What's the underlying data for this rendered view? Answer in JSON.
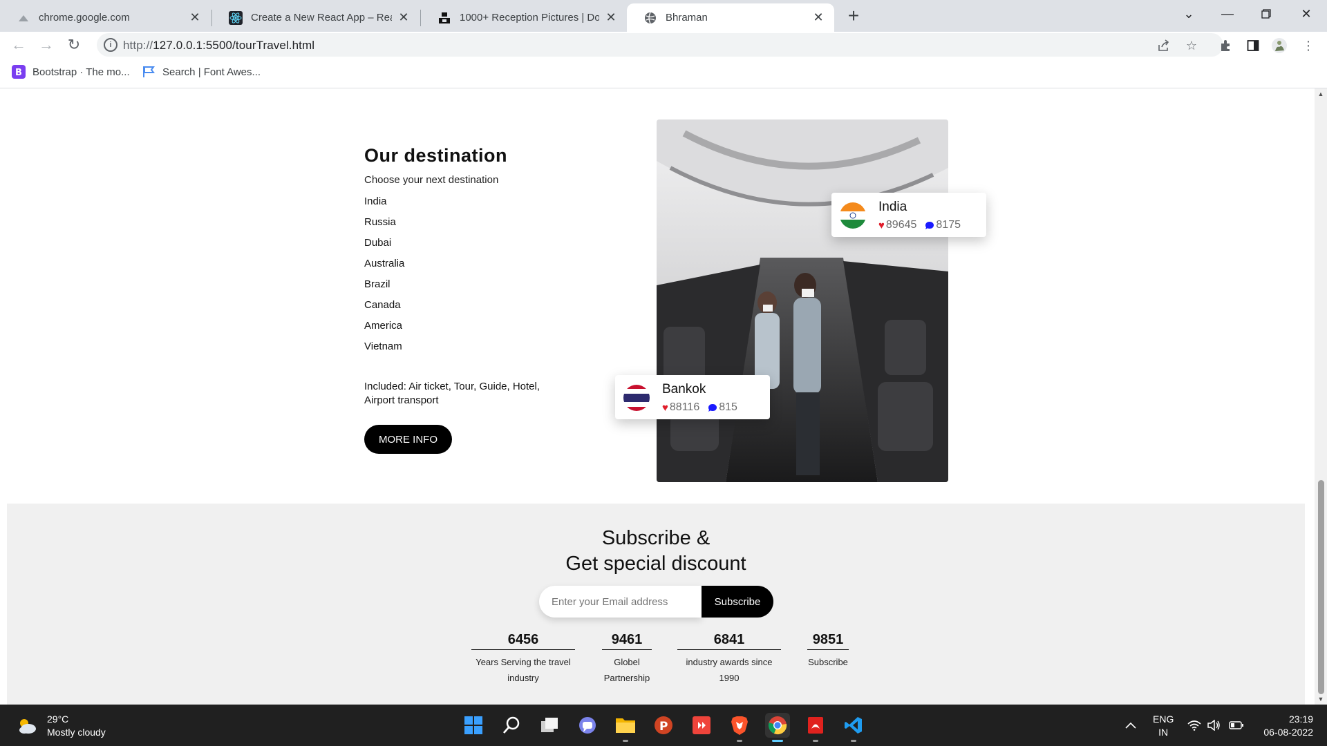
{
  "browser": {
    "tabs": [
      {
        "title": "chrome.google.com",
        "icon": "chrome-webstore-icon",
        "active": false
      },
      {
        "title": "Create a New React App – React",
        "icon": "react-icon",
        "active": false
      },
      {
        "title": "1000+ Reception Pictures | Down",
        "icon": "unsplash-icon",
        "active": false
      },
      {
        "title": "Bhraman",
        "icon": "globe-icon",
        "active": true
      }
    ],
    "url_prefix": "http://",
    "url_main": "127.0.0.1:5500/tourTravel.html",
    "bookmarks": [
      {
        "label": "Bootstrap · The mo...",
        "icon": "bootstrap-icon"
      },
      {
        "label": "Search | Font Awes...",
        "icon": "font-awesome-flag-icon"
      }
    ]
  },
  "destination": {
    "title": "Our destination",
    "subtitle": "Choose your next destination",
    "countries": [
      "India",
      "Russia",
      "Dubai",
      "Australia",
      "Brazil",
      "Canada",
      "America",
      "Vietnam"
    ],
    "included": "Included: Air ticket, Tour, Guide, Hotel, Airport transport",
    "button": "MORE INFO"
  },
  "cards": [
    {
      "name": "India",
      "likes": "89645",
      "comments": "8175",
      "flag": "india-flag-icon"
    },
    {
      "name": "Bankok",
      "likes": "88116",
      "comments": "815",
      "flag": "thailand-flag-icon"
    }
  ],
  "subscribe": {
    "title_line1": "Subscribe &",
    "title_line2": "Get special discount",
    "placeholder": "Enter your Email address",
    "button": "Subscribe"
  },
  "stats": [
    {
      "value": "6456",
      "label_line1": "Years Serving the travel",
      "label_line2": "industry"
    },
    {
      "value": "9461",
      "label_line1": "Globel",
      "label_line2": "Partnership"
    },
    {
      "value": "6841",
      "label_line1": "industry awards since",
      "label_line2": "1990"
    },
    {
      "value": "9851",
      "label_line1": "Subscribe",
      "label_line2": ""
    }
  ],
  "taskbar": {
    "temperature": "29°C",
    "weather": "Mostly cloudy",
    "lang1": "ENG",
    "lang2": "IN",
    "time": "23:19",
    "date": "06-08-2022"
  },
  "colors": {
    "accent_black": "#000000",
    "heart": "#e01e2b",
    "comment": "#1a1aff",
    "section_bg": "#f0f0f0"
  }
}
